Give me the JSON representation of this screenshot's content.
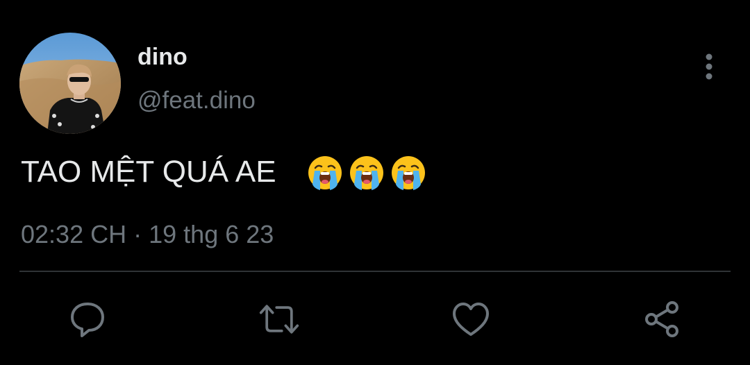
{
  "user": {
    "display_name": "dino",
    "handle": "@feat.dino"
  },
  "tweet": {
    "text": "TAO MỆT QUÁ AE",
    "emojis": [
      "loudly-crying-face",
      "loudly-crying-face",
      "loudly-crying-face"
    ],
    "time": "02:32 CH",
    "separator": "·",
    "date": "19 thg 6 23"
  },
  "actions": [
    {
      "name": "reply",
      "icon": "speech-bubble-icon"
    },
    {
      "name": "retweet",
      "icon": "retweet-icon"
    },
    {
      "name": "like",
      "icon": "heart-icon"
    },
    {
      "name": "share",
      "icon": "share-icon"
    }
  ],
  "colors": {
    "background": "#000000",
    "primary_text": "#e7e9ea",
    "secondary_text": "#6e767d",
    "divider": "#2f3336"
  }
}
